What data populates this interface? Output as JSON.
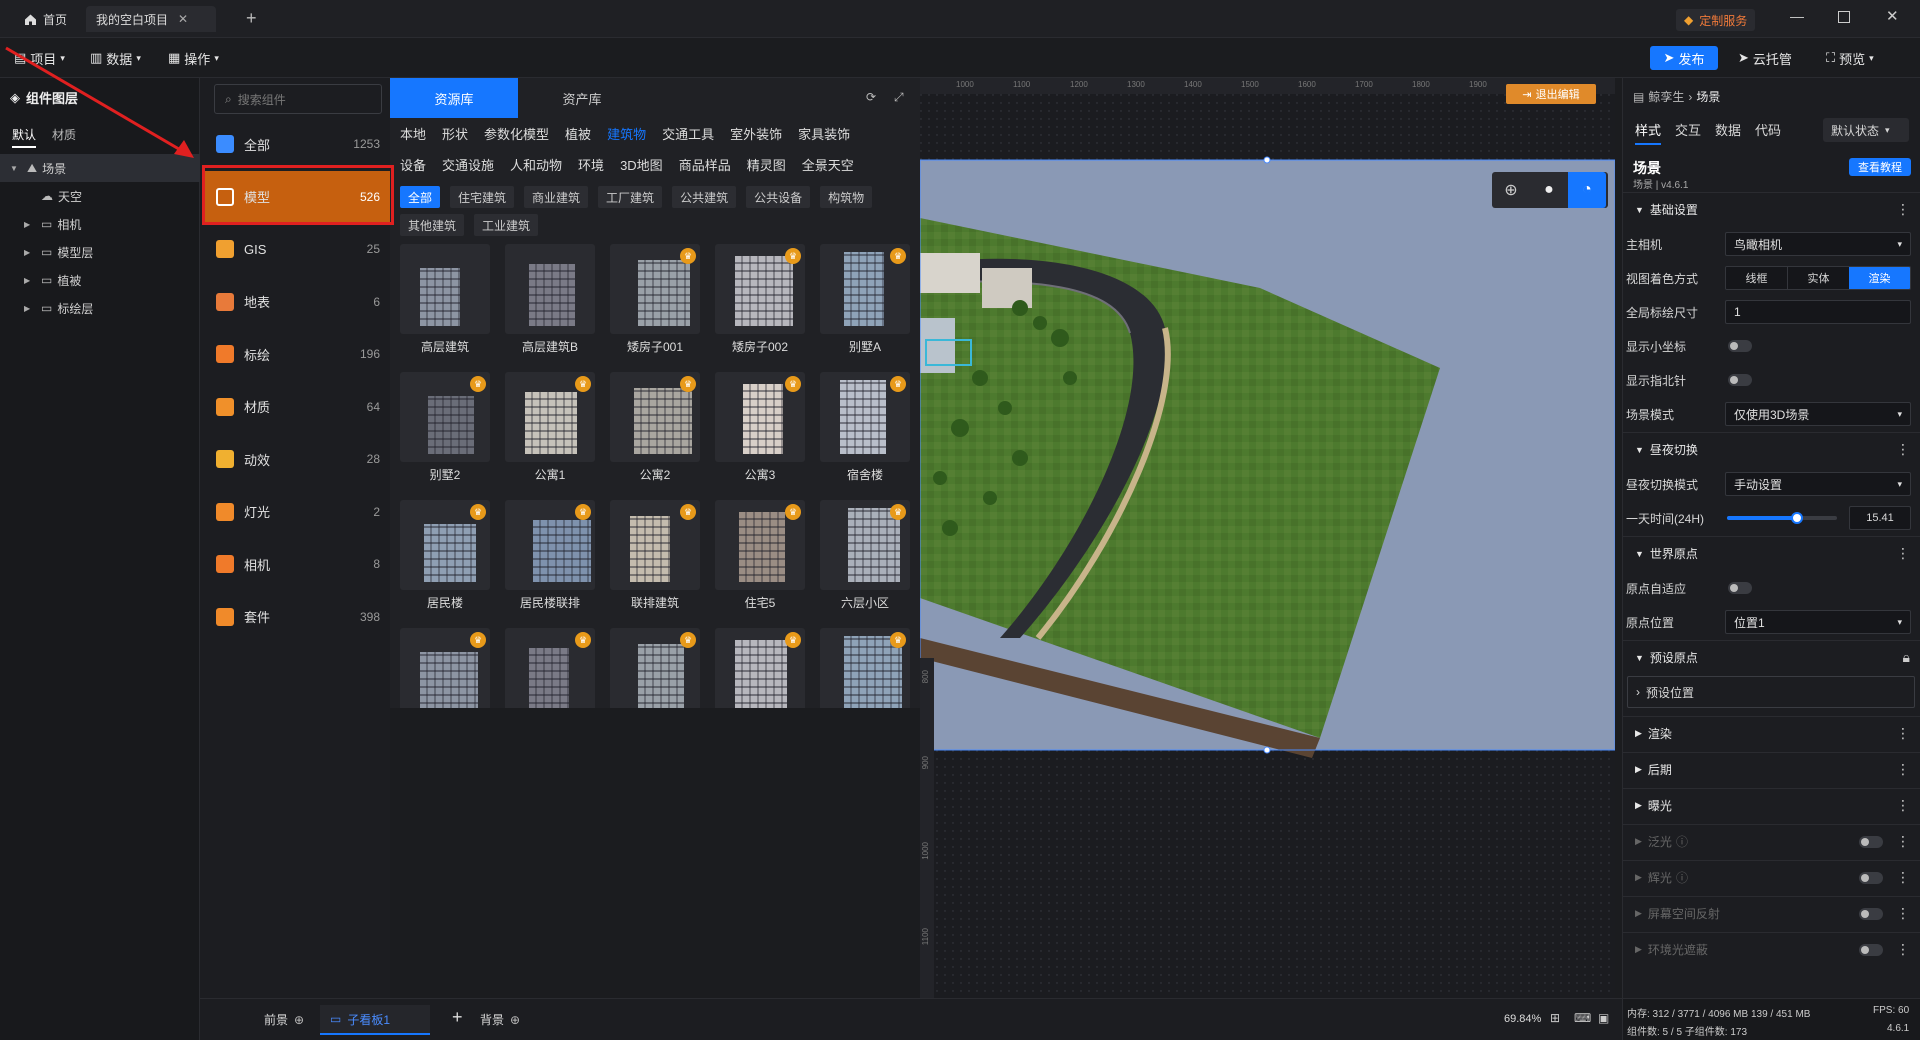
{
  "titlebar": {
    "home_tab": "首页",
    "project_tab": "我的空白项目",
    "custom_service": "定制服务"
  },
  "menubar": {
    "project": "项目",
    "data": "数据",
    "operation": "操作",
    "publish": "发布",
    "cloud": "云托管",
    "preview": "预览"
  },
  "layer_panel": {
    "title": "组件图层",
    "tabs": [
      "默认",
      "材质"
    ],
    "tree": [
      {
        "label": "场景",
        "level": 0,
        "selected": true
      },
      {
        "label": "天空",
        "level": 1
      },
      {
        "label": "相机",
        "level": 1
      },
      {
        "label": "模型层",
        "level": 1
      },
      {
        "label": "植被",
        "level": 1
      },
      {
        "label": "标绘层",
        "level": 1
      }
    ]
  },
  "search": {
    "placeholder": "搜索组件"
  },
  "categories": [
    {
      "label": "全部",
      "count": "1253",
      "color": "#3b8cff"
    },
    {
      "label": "模型",
      "count": "526",
      "color": "#ffffff",
      "selected": true
    },
    {
      "label": "GIS",
      "count": "25",
      "color": "#f0a030"
    },
    {
      "label": "地表",
      "count": "6",
      "color": "#e87a3a"
    },
    {
      "label": "标绘",
      "count": "196",
      "color": "#f07a2a"
    },
    {
      "label": "材质",
      "count": "64",
      "color": "#f0902a"
    },
    {
      "label": "动效",
      "count": "28",
      "color": "#f0b030"
    },
    {
      "label": "灯光",
      "count": "2",
      "color": "#f08a2a"
    },
    {
      "label": "相机",
      "count": "8",
      "color": "#f07a2a"
    },
    {
      "label": "套件",
      "count": "398",
      "color": "#f08a2a"
    }
  ],
  "resource_panel": {
    "tabs": [
      "资源库",
      "资产库"
    ],
    "subtabs_row1": [
      "本地",
      "形状",
      "参数化模型",
      "植被",
      "建筑物",
      "交通工具",
      "室外装饰",
      "家具装饰"
    ],
    "subtabs_row2": [
      "设备",
      "交通设施",
      "人和动物",
      "环境",
      "3D地图",
      "商品样品",
      "精灵图",
      "全景天空"
    ],
    "active_subtab": "建筑物",
    "chips_row1": [
      "全部",
      "住宅建筑",
      "商业建筑",
      "工厂建筑",
      "公共建筑",
      "公共设备",
      "构筑物"
    ],
    "chips_row2": [
      "其他建筑",
      "工业建筑"
    ],
    "models": [
      {
        "label": "高层建筑",
        "crown": false
      },
      {
        "label": "高层建筑B",
        "crown": false
      },
      {
        "label": "矮房子001",
        "crown": true
      },
      {
        "label": "矮房子002",
        "crown": true
      },
      {
        "label": "别墅A",
        "crown": true
      },
      {
        "label": "别墅2",
        "crown": true
      },
      {
        "label": "公寓1",
        "crown": true
      },
      {
        "label": "公寓2",
        "crown": true
      },
      {
        "label": "公寓3",
        "crown": true
      },
      {
        "label": "宿舍楼",
        "crown": true
      },
      {
        "label": "居民楼",
        "crown": true
      },
      {
        "label": "居民楼联排",
        "crown": true
      },
      {
        "label": "联排建筑",
        "crown": true
      },
      {
        "label": "住宅5",
        "crown": true
      },
      {
        "label": "六层小区",
        "crown": true
      },
      {
        "label": "",
        "crown": true
      },
      {
        "label": "",
        "crown": true
      },
      {
        "label": "",
        "crown": true
      },
      {
        "label": "",
        "crown": true
      },
      {
        "label": "",
        "crown": true
      }
    ]
  },
  "viewport": {
    "exit_edit": "退出编辑",
    "ruler_top": [
      "1000",
      "1100",
      "1200",
      "1300",
      "1400",
      "1500",
      "1600",
      "1700",
      "1800",
      "1900"
    ],
    "ruler_left": [
      "800",
      "900",
      "1000",
      "1100"
    ]
  },
  "right_panel": {
    "breadcrumb_user": "鲸孪生",
    "breadcrumb_page": "场景",
    "tabs": [
      "样式",
      "交互",
      "数据",
      "代码"
    ],
    "state_select": "默认状态",
    "title": "场景",
    "subtitle": "场景 | v4.6.1",
    "tutorial": "查看教程",
    "basic_section": "基础设置",
    "main_camera_label": "主相机",
    "main_camera_value": "鸟瞰相机",
    "view_shading_label": "视图着色方式",
    "shading_options": [
      "线框",
      "实体",
      "渲染"
    ],
    "shading_selected": "渲染",
    "global_scale_label": "全局标绘尺寸",
    "global_scale_value": "1",
    "show_axis_label": "显示小坐标",
    "show_compass_label": "显示指北针",
    "scene_mode_label": "场景模式",
    "scene_mode_value": "仅使用3D场景",
    "daynight_section": "昼夜切换",
    "daynight_mode_label": "昼夜切换模式",
    "daynight_mode_value": "手动设置",
    "day_time_label": "一天时间(24H)",
    "day_time_value": "15.41",
    "day_time_fraction": 0.64,
    "world_origin_section": "世界原点",
    "origin_auto_label": "原点自适应",
    "origin_pos_label": "原点位置",
    "origin_pos_value": "位置1",
    "preset_origin_section": "预设原点",
    "preset_position": "预设位置",
    "render_section": "渲染",
    "post_section": "后期",
    "exposure_section": "曝光",
    "bloom": "泛光",
    "glow": "辉光",
    "ssr": "屏幕空间反射",
    "ao": "环境光遮蔽"
  },
  "bottom_bar": {
    "front": "前景",
    "sub_board": "子看板1",
    "background": "背景",
    "zoom": "69.84%"
  },
  "status": {
    "memory": "内存:  312 / 3771 / 4096 MB  139 / 451 MB",
    "fps": "FPS:  60",
    "components": "组件数: 5 / 5    子组件数: 173",
    "version": "4.6.1"
  },
  "colors": {
    "accent": "#1677ff",
    "selected_category": "#c6600f",
    "highlight_box": "#e02020",
    "canvas_bg": "#8a99b5",
    "grass": "#4d7a2e"
  }
}
